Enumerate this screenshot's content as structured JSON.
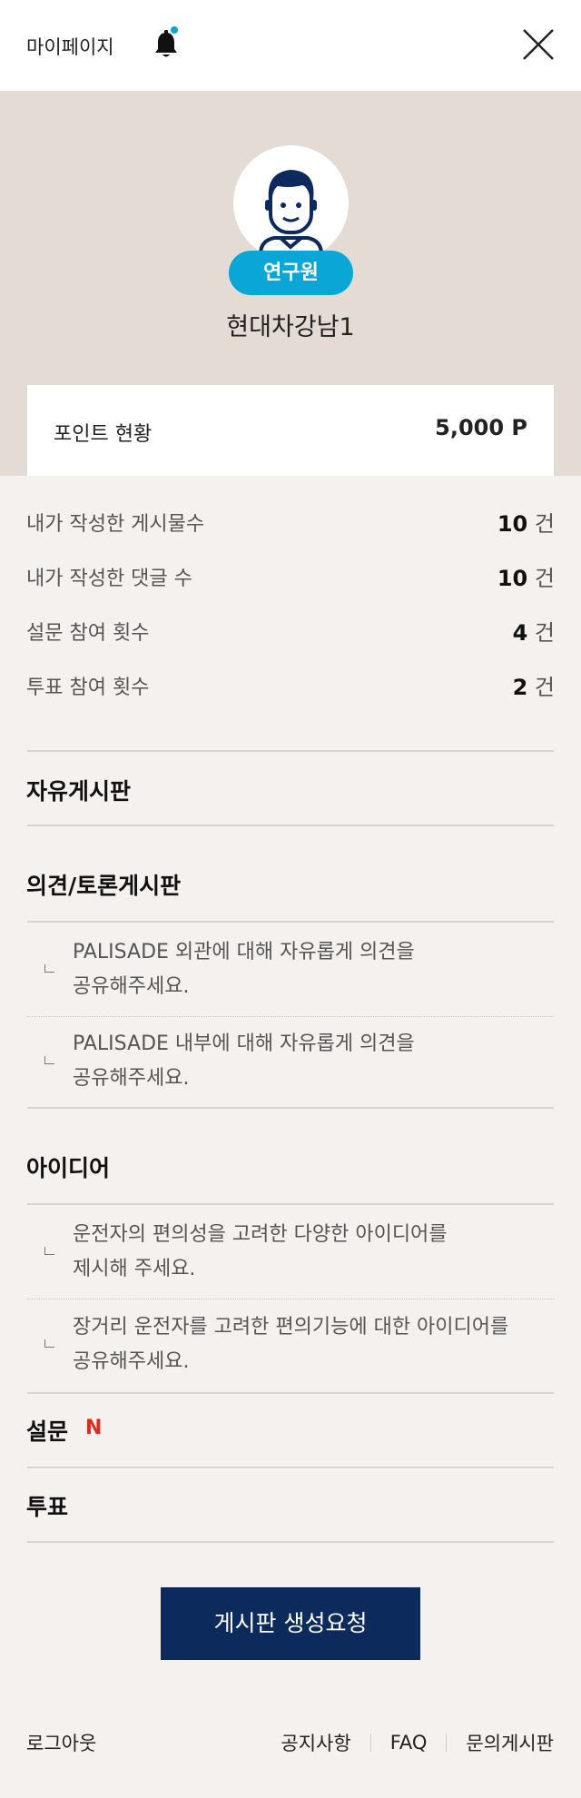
{
  "header": {
    "title": "마이페이지"
  },
  "profile": {
    "badge": "연구원",
    "name": "현대차강남1"
  },
  "points": {
    "label": "포인트 현황",
    "value": "5,000 P"
  },
  "stats": [
    {
      "label": "내가 작성한 게시물수",
      "count": "10",
      "unit": "건"
    },
    {
      "label": "내가 작성한 댓글 수",
      "count": "10",
      "unit": "건"
    },
    {
      "label": "설문 참여 횟수",
      "count": "4",
      "unit": "건"
    },
    {
      "label": "투표 참여 횟수",
      "count": "2",
      "unit": "건"
    }
  ],
  "menu": {
    "free_board": "자유게시판",
    "opinion_board": "의견/토론게시판",
    "opinion_items": [
      {
        "line1": "PALISADE 외관에 대해 자유롭게 의견을",
        "line2": "공유해주세요."
      },
      {
        "line1": "PALISADE 내부에 대해 자유롭게 의견을",
        "line2": "공유해주세요."
      }
    ],
    "idea": "아이디어",
    "idea_items": [
      {
        "line1": "운전자의 편의성을 고려한 다양한 아이디어를",
        "line2": "제시해 주세요."
      },
      {
        "line1": "장거리 운전자를 고려한 편의기능에 대한 아이디어를",
        "line2": "공유해주세요."
      }
    ],
    "survey": "설문",
    "survey_new": "N",
    "vote": "투표"
  },
  "cta": {
    "label": "게시판 생성요청"
  },
  "footer": {
    "logout": "로그아웃",
    "links": [
      "공지사항",
      "FAQ",
      "문의게시판"
    ]
  },
  "colors": {
    "accent": "#0aa6d6",
    "navy": "#0c2a5b",
    "new": "#e0291b",
    "profile_bg": "#e3dbd4",
    "page_bg": "#f4f1ef"
  }
}
